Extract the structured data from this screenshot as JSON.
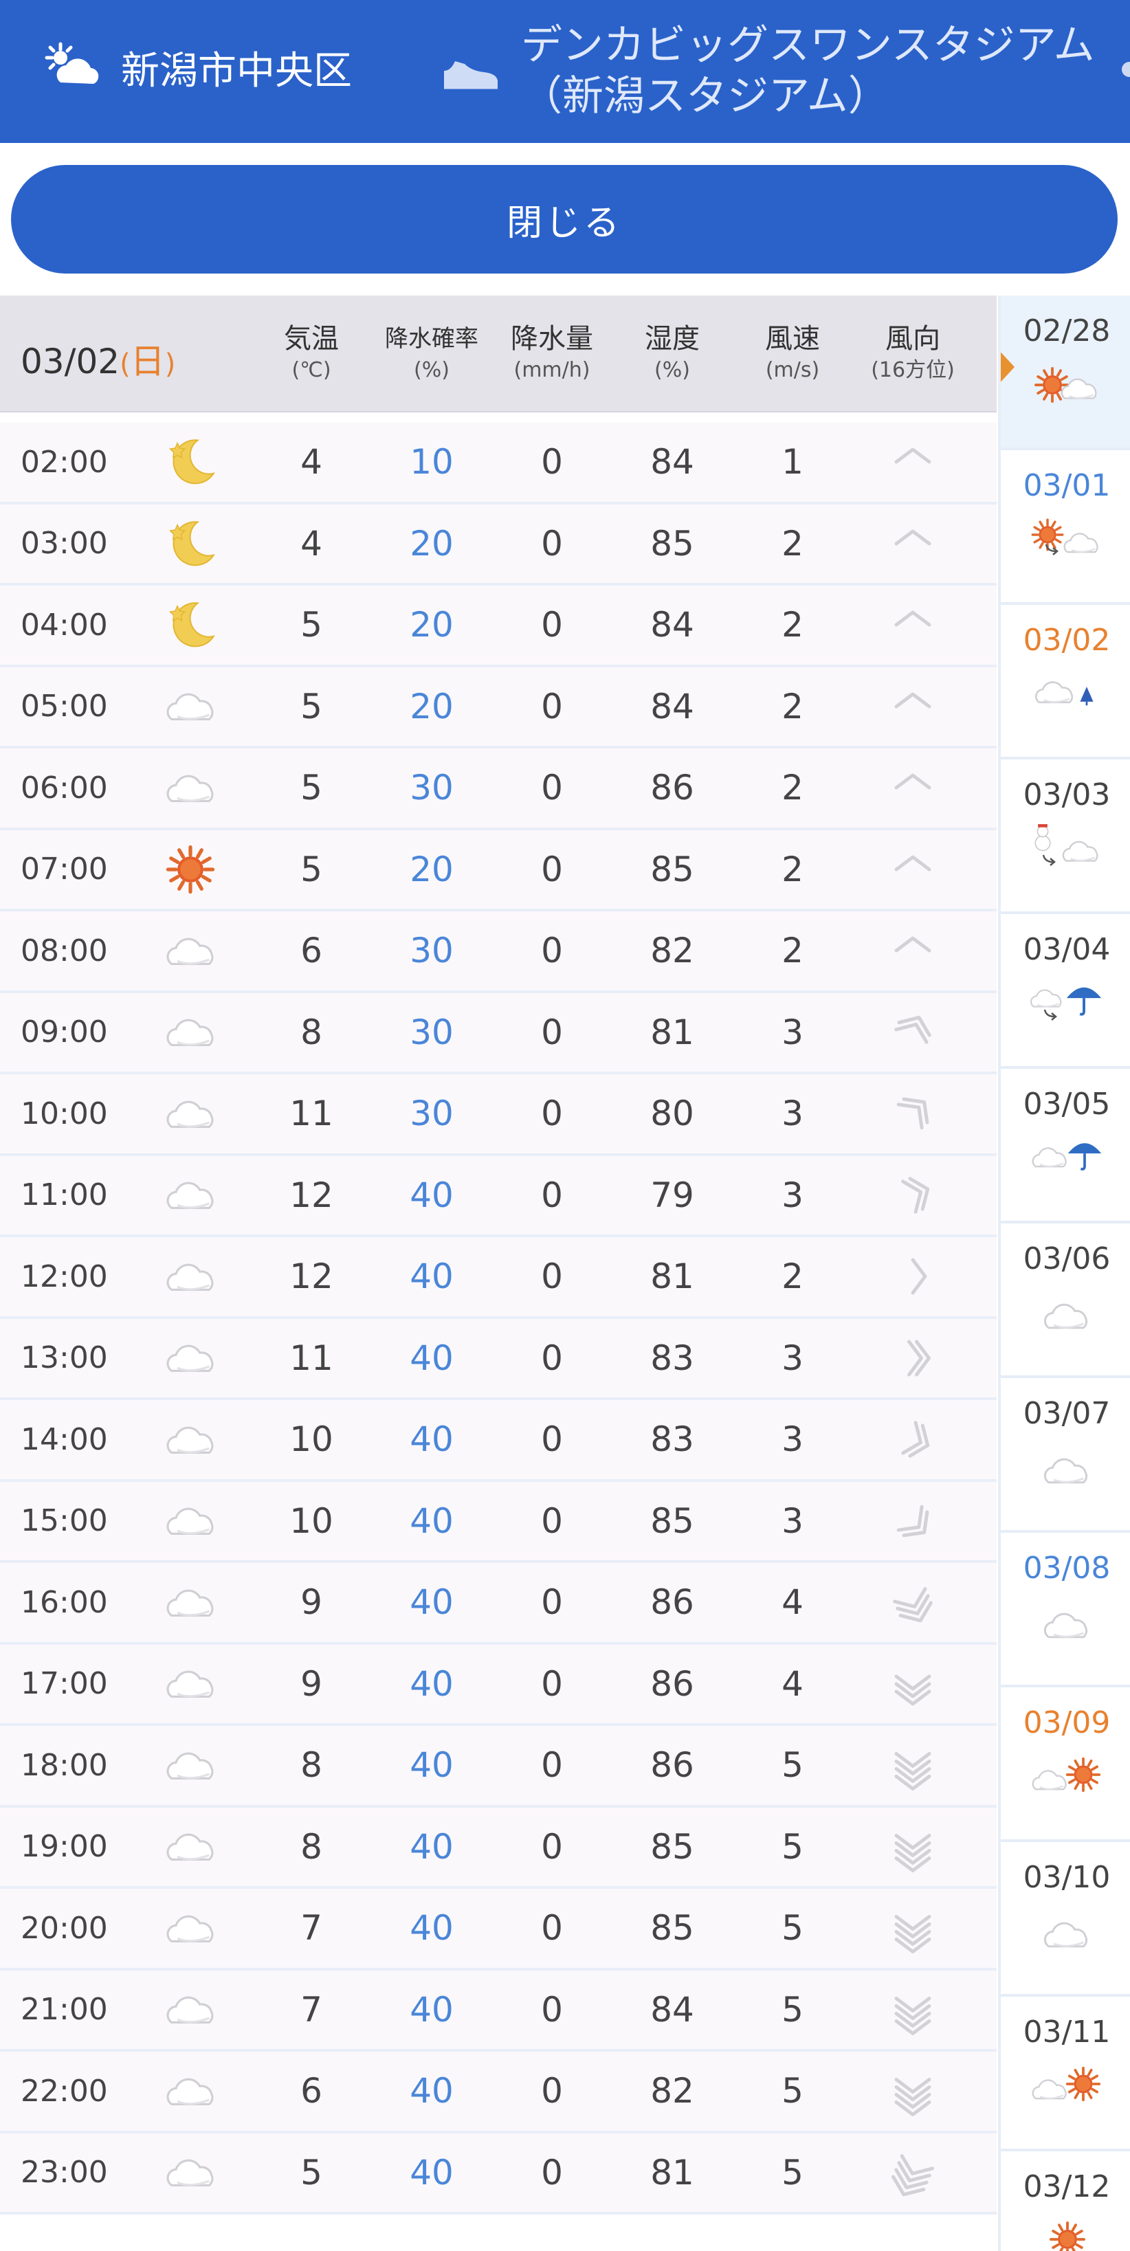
{
  "header": {
    "locations": [
      {
        "label": "新潟市中央区",
        "icon": "partly-cloudy-icon"
      },
      {
        "label": "デンカビッグスワンスタジアム（新潟スタジアム）",
        "icon": "sneaker-icon"
      }
    ]
  },
  "close_button": "閉じる",
  "table": {
    "date": "03/02",
    "dow": "日",
    "columns": [
      {
        "label": "気温",
        "unit": "(℃)"
      },
      {
        "label": "降水確率",
        "unit": "(%)"
      },
      {
        "label": "降水量",
        "unit": "(mm/h)"
      },
      {
        "label": "湿度",
        "unit": "(%)"
      },
      {
        "label": "風速",
        "unit": "(m/s)"
      },
      {
        "label": "風向",
        "unit": "(16方位)"
      }
    ],
    "rows": [
      {
        "time": "02:00",
        "weather": "moon",
        "temp": "4",
        "pop": "10",
        "precip": "0",
        "humidity": "84",
        "wind_speed": "1",
        "wind_dir": "N"
      },
      {
        "time": "03:00",
        "weather": "moon",
        "temp": "4",
        "pop": "20",
        "precip": "0",
        "humidity": "85",
        "wind_speed": "2",
        "wind_dir": "N"
      },
      {
        "time": "04:00",
        "weather": "moon",
        "temp": "5",
        "pop": "20",
        "precip": "0",
        "humidity": "84",
        "wind_speed": "2",
        "wind_dir": "N"
      },
      {
        "time": "05:00",
        "weather": "cloud",
        "temp": "5",
        "pop": "20",
        "precip": "0",
        "humidity": "84",
        "wind_speed": "2",
        "wind_dir": "N"
      },
      {
        "time": "06:00",
        "weather": "cloud",
        "temp": "5",
        "pop": "30",
        "precip": "0",
        "humidity": "86",
        "wind_speed": "2",
        "wind_dir": "N"
      },
      {
        "time": "07:00",
        "weather": "sun",
        "temp": "5",
        "pop": "20",
        "precip": "0",
        "humidity": "85",
        "wind_speed": "2",
        "wind_dir": "N"
      },
      {
        "time": "08:00",
        "weather": "cloud",
        "temp": "6",
        "pop": "30",
        "precip": "0",
        "humidity": "82",
        "wind_speed": "2",
        "wind_dir": "N"
      },
      {
        "time": "09:00",
        "weather": "cloud",
        "temp": "8",
        "pop": "30",
        "precip": "0",
        "humidity": "81",
        "wind_speed": "3",
        "wind_dir": "NNE"
      },
      {
        "time": "10:00",
        "weather": "cloud",
        "temp": "11",
        "pop": "30",
        "precip": "0",
        "humidity": "80",
        "wind_speed": "3",
        "wind_dir": "NE"
      },
      {
        "time": "11:00",
        "weather": "cloud",
        "temp": "12",
        "pop": "40",
        "precip": "0",
        "humidity": "79",
        "wind_speed": "3",
        "wind_dir": "ENE"
      },
      {
        "time": "12:00",
        "weather": "cloud",
        "temp": "12",
        "pop": "40",
        "precip": "0",
        "humidity": "81",
        "wind_speed": "2",
        "wind_dir": "E"
      },
      {
        "time": "13:00",
        "weather": "cloud",
        "temp": "11",
        "pop": "40",
        "precip": "0",
        "humidity": "83",
        "wind_speed": "3",
        "wind_dir": "E"
      },
      {
        "time": "14:00",
        "weather": "cloud",
        "temp": "10",
        "pop": "40",
        "precip": "0",
        "humidity": "83",
        "wind_speed": "3",
        "wind_dir": "ESE"
      },
      {
        "time": "15:00",
        "weather": "cloud",
        "temp": "10",
        "pop": "40",
        "precip": "0",
        "humidity": "85",
        "wind_speed": "3",
        "wind_dir": "SE"
      },
      {
        "time": "16:00",
        "weather": "cloud",
        "temp": "9",
        "pop": "40",
        "precip": "0",
        "humidity": "86",
        "wind_speed": "4",
        "wind_dir": "SSE"
      },
      {
        "time": "17:00",
        "weather": "cloud",
        "temp": "9",
        "pop": "40",
        "precip": "0",
        "humidity": "86",
        "wind_speed": "4",
        "wind_dir": "S"
      },
      {
        "time": "18:00",
        "weather": "cloud",
        "temp": "8",
        "pop": "40",
        "precip": "0",
        "humidity": "86",
        "wind_speed": "5",
        "wind_dir": "S"
      },
      {
        "time": "19:00",
        "weather": "cloud",
        "temp": "8",
        "pop": "40",
        "precip": "0",
        "humidity": "85",
        "wind_speed": "5",
        "wind_dir": "S"
      },
      {
        "time": "20:00",
        "weather": "cloud",
        "temp": "7",
        "pop": "40",
        "precip": "0",
        "humidity": "85",
        "wind_speed": "5",
        "wind_dir": "S"
      },
      {
        "time": "21:00",
        "weather": "cloud",
        "temp": "7",
        "pop": "40",
        "precip": "0",
        "humidity": "84",
        "wind_speed": "5",
        "wind_dir": "S"
      },
      {
        "time": "22:00",
        "weather": "cloud",
        "temp": "6",
        "pop": "40",
        "precip": "0",
        "humidity": "82",
        "wind_speed": "5",
        "wind_dir": "S"
      },
      {
        "time": "23:00",
        "weather": "cloud",
        "temp": "5",
        "pop": "40",
        "precip": "0",
        "humidity": "81",
        "wind_speed": "5",
        "wind_dir": "SSW"
      }
    ]
  },
  "days": [
    {
      "date": "02/28",
      "type": "weekday",
      "weather": "sun-cloud",
      "selected": false,
      "pointer": true
    },
    {
      "date": "03/01",
      "type": "sat",
      "weather": "sun-then-cloud"
    },
    {
      "date": "03/02",
      "type": "sun",
      "weather": "cloud-snow"
    },
    {
      "date": "03/03",
      "type": "weekday",
      "weather": "snow-then-cloud"
    },
    {
      "date": "03/04",
      "type": "weekday",
      "weather": "cloud-then-rain"
    },
    {
      "date": "03/05",
      "type": "weekday",
      "weather": "cloud-rain"
    },
    {
      "date": "03/06",
      "type": "weekday",
      "weather": "cloud"
    },
    {
      "date": "03/07",
      "type": "weekday",
      "weather": "cloud"
    },
    {
      "date": "03/08",
      "type": "sat",
      "weather": "cloud"
    },
    {
      "date": "03/09",
      "type": "sun",
      "weather": "cloud-sun"
    },
    {
      "date": "03/10",
      "type": "weekday",
      "weather": "cloud"
    },
    {
      "date": "03/11",
      "type": "weekday",
      "weather": "cloud-sun"
    },
    {
      "date": "03/12",
      "type": "weekday",
      "weather": "sun"
    }
  ],
  "colors": {
    "brand": "#2a62c9",
    "pop_text": "#4a86d8",
    "sunday": "#e8812f",
    "saturday": "#4a86d8"
  }
}
